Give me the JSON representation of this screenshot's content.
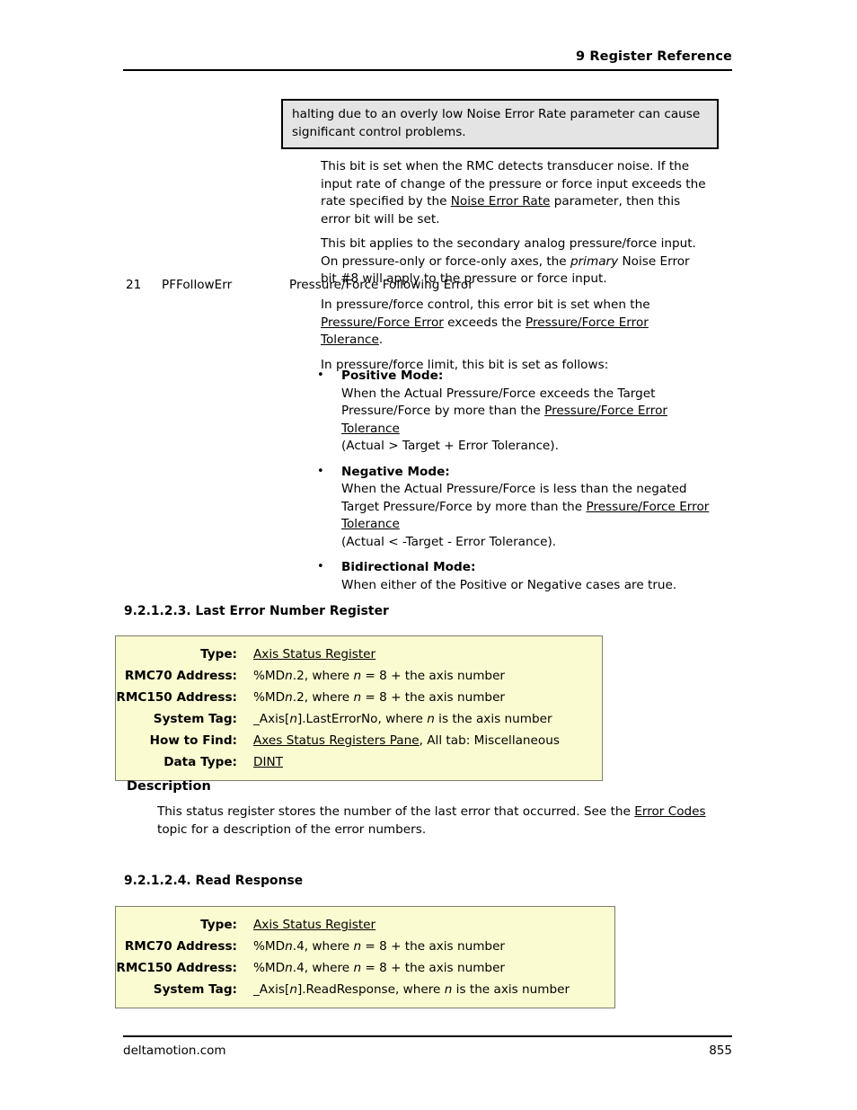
{
  "header": {
    "chapter_title": "9  Register Reference"
  },
  "footer": {
    "site": "deltamotion.com",
    "page_number": "855"
  },
  "note_box": {
    "text": "halting due to an overly low Noise Error Rate parameter can cause significant control problems."
  },
  "noise_error_paragraphs": {
    "p1_a": "This bit is set when the RMC detects transducer noise. If the input rate of change of the pressure or force input exceeds the rate specified by the ",
    "p1_link": "Noise Error Rate",
    "p1_b": " parameter, then this error bit will be set.",
    "p2_a": "This bit applies to the secondary analog pressure/force input. On pressure-only or force-only axes, the ",
    "p2_em": "primary",
    "p2_b": " Noise Error bit #8 will apply to the pressure or force input."
  },
  "bit_row": {
    "number": "21",
    "name": "PFFollowErr",
    "description": "Pressure/Force Following Error"
  },
  "follow_err": {
    "p1_a": "In pressure/force control, this error bit is set when the ",
    "p1_link1": "Pressure/Force Error",
    "p1_b": " exceeds the ",
    "p1_link2": "Pressure/Force Error Tolerance",
    "p1_c": ".",
    "p2": "In pressure/force limit, this bit is set as follows:"
  },
  "modes": [
    {
      "title": "Positive Mode:",
      "body_a": "When the Actual Pressure/Force exceeds the Target Pressure/Force by more than the ",
      "link": "Pressure/Force Error Tolerance",
      "body_b": "",
      "formula": "(Actual > Target + Error Tolerance)."
    },
    {
      "title": "Negative Mode:",
      "body_a": "When the Actual Pressure/Force is less than the negated Target Pressure/Force by more than the ",
      "link": "Pressure/Force Error Tolerance",
      "body_b": "",
      "formula": "(Actual < -Target - Error Tolerance)."
    },
    {
      "title": "Bidirectional Mode:",
      "body_a": "When either of the Positive or Negative cases are true.",
      "link": "",
      "body_b": "",
      "formula": ""
    }
  ],
  "section_last_error": {
    "heading": "9.2.1.2.3. Last Error Number Register",
    "table": [
      {
        "label": "Type:",
        "value": "Axis Status Register",
        "style": "link"
      },
      {
        "label": "RMC70 Address:",
        "value": "%MDn.2, where n = 8 + the axis number",
        "style": "code-n"
      },
      {
        "label": "RMC150 Address:",
        "value": "%MDn.2, where n = 8 + the axis number",
        "style": "code-n"
      },
      {
        "label": "System Tag:",
        "value": "_Axis[n].LastErrorNo, where n is the axis number",
        "style": "tag-n"
      },
      {
        "label": "How to Find:",
        "value": "Axes Status Registers Pane, All tab: Miscellaneous",
        "style": "link-partial"
      },
      {
        "label": "Data Type:",
        "value": "DINT",
        "style": "link"
      }
    ],
    "description_heading": "Description",
    "description_a": "This status register stores the number of the last error that occurred. See the ",
    "description_link": "Error Codes",
    "description_b": " topic for a description of the error numbers."
  },
  "section_read_response": {
    "heading": "9.2.1.2.4. Read Response",
    "table": [
      {
        "label": "Type:",
        "value": "Axis Status Register",
        "style": "link"
      },
      {
        "label": "RMC70 Address:",
        "value": "%MDn.4, where n = 8 + the axis number",
        "style": "code-n"
      },
      {
        "label": "RMC150 Address:",
        "value": "%MDn.4, where n = 8 + the axis number",
        "style": "code-n"
      },
      {
        "label": "System Tag:",
        "value": "_Axis[n].ReadResponse, where n is the axis number",
        "style": "tag-n"
      }
    ]
  },
  "colors": {
    "note_box_bg": "#e4e4e4",
    "spec_table_bg": "#fbfbd2",
    "spec_table_border": "#7d7d6e",
    "text": "#000000"
  }
}
